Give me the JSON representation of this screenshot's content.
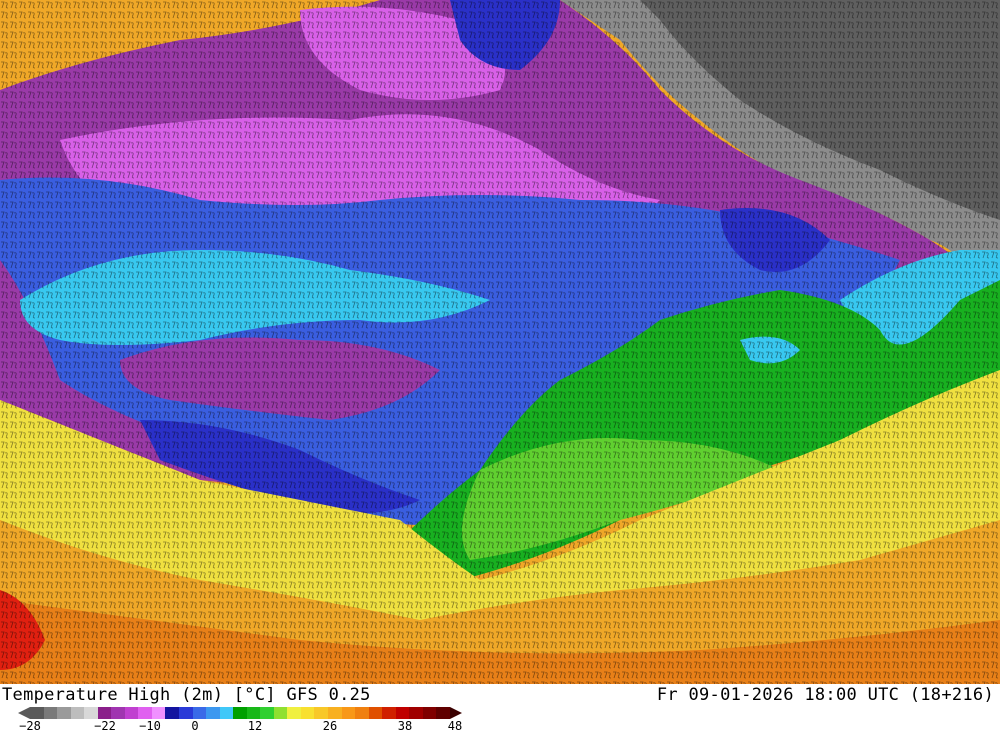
{
  "header": {
    "title_left": "Temperature High (2m) [°C] GFS 0.25",
    "title_right": "Fr 09-01-2026 18:00 UTC (18+216)"
  },
  "legend": {
    "tick_labels": [
      "−28",
      "−22",
      "−10",
      "0",
      "12",
      "26",
      "38",
      "48"
    ],
    "colors": [
      "#5a5a5a",
      "#7a7a7a",
      "#9a9a9a",
      "#bdbdbd",
      "#d8d8d8",
      "#8a1f8a",
      "#a035b0",
      "#c040d0",
      "#e060f0",
      "#f090ff",
      "#1414a0",
      "#2a3ad8",
      "#3a6ae8",
      "#3c98f0",
      "#40c8f8",
      "#00a000",
      "#18b818",
      "#30d030",
      "#90e030",
      "#f0f040",
      "#f8e030",
      "#f8c828",
      "#f8b020",
      "#f89818",
      "#f08010",
      "#e05000",
      "#d02000",
      "#c00000",
      "#a00000",
      "#800000",
      "#600000"
    ]
  },
  "map": {
    "colors": {
      "grey": "#8c8c8c",
      "dark_grey": "#5f5f5f",
      "purple": "#9a3aa8",
      "magenta": "#d860e8",
      "blue": "#3a5ee0",
      "dark_blue": "#2a30c8",
      "cyan": "#38c8f0",
      "green": "#18b020",
      "light_green": "#60d030",
      "yellow": "#f0e040",
      "orange": "#f0a828",
      "dark_orange": "#e88018",
      "red": "#e02010"
    }
  }
}
